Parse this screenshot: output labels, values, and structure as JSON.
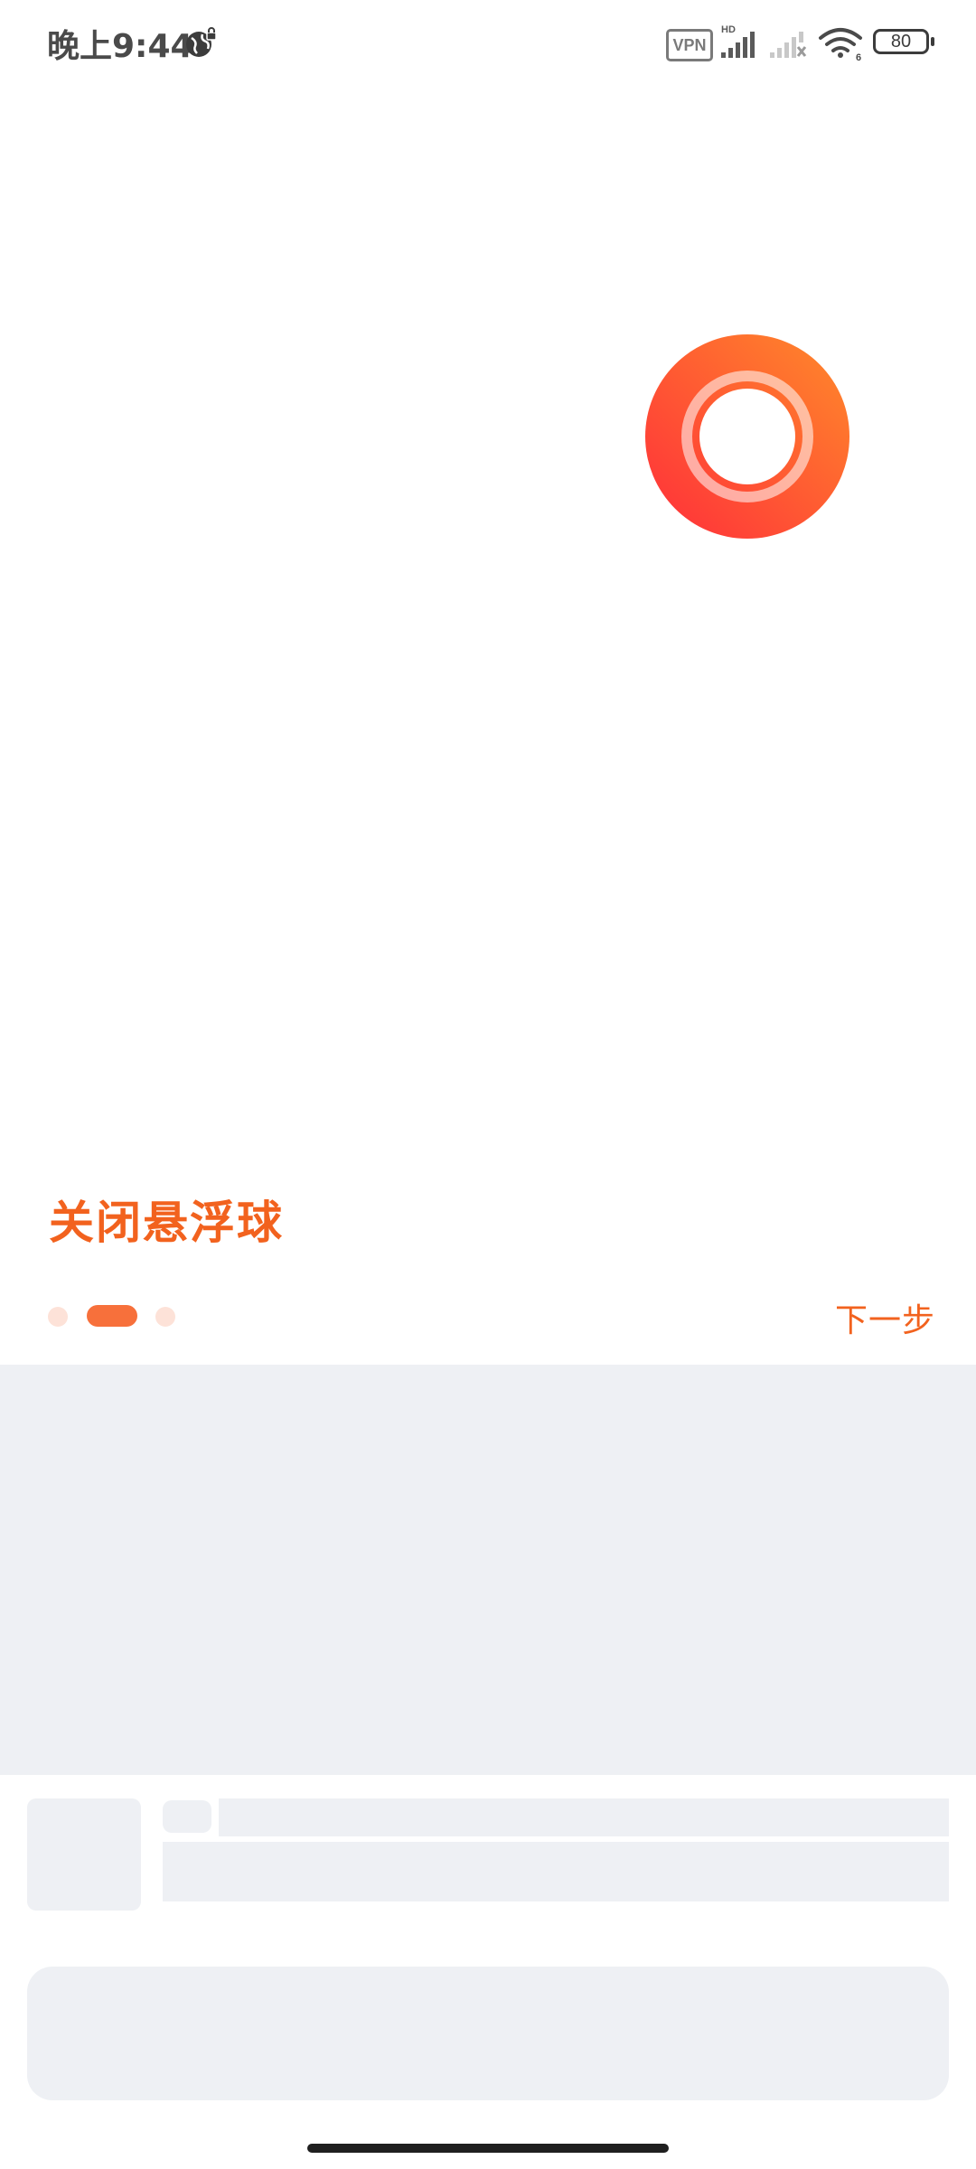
{
  "status_bar": {
    "time": "晚上9:44",
    "vpn_label": "VPN",
    "hd_label": "HD",
    "wifi_label": "6",
    "battery_level": "80",
    "icons": [
      "globe-lock-icon",
      "vpn-icon",
      "signal-hd-icon",
      "signal-no-service-icon",
      "wifi-icon",
      "battery-icon"
    ]
  },
  "guide": {
    "title": "关闭悬浮球",
    "next_label": "下一步",
    "page_indicator": {
      "total": 3,
      "current": 2
    }
  },
  "colors": {
    "accent": "#f2621e",
    "dot_active": "#f7703b",
    "dot_inactive": "#fde2d8",
    "skeleton": "#eef0f4"
  }
}
